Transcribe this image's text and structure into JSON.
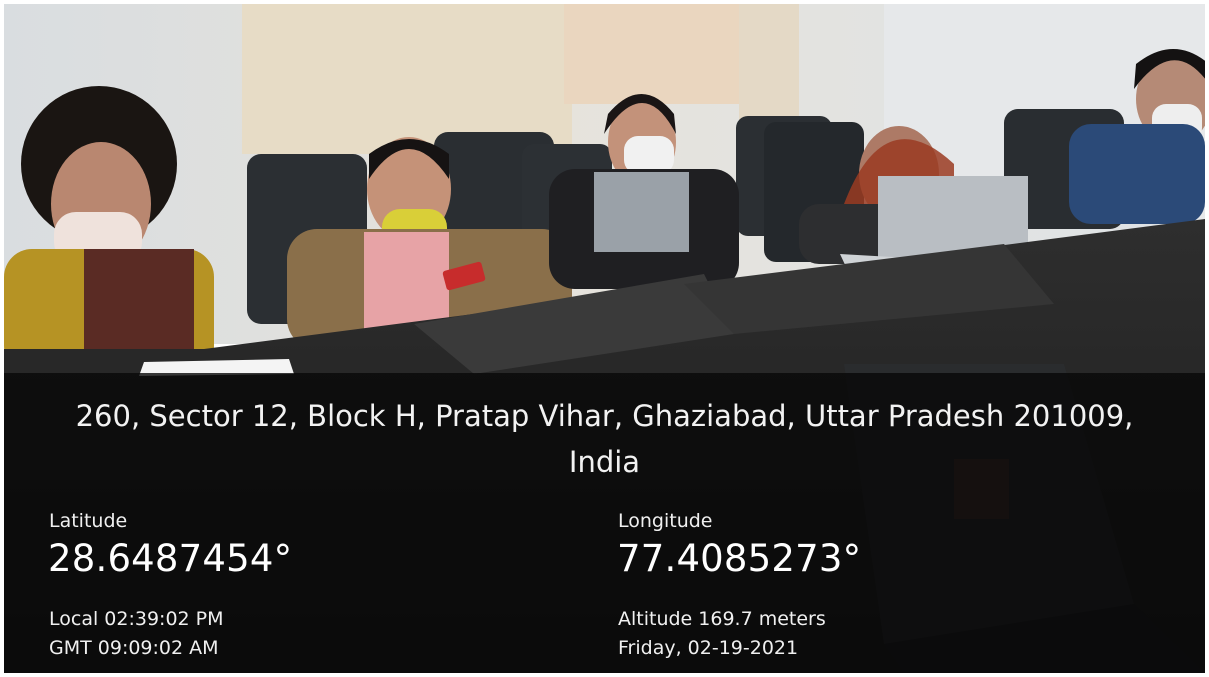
{
  "location": {
    "address_line1": "260, Sector 12, Block H, Pratap Vihar, Ghaziabad, Uttar Pradesh 201009,",
    "address_line2": "India"
  },
  "coordinates": {
    "latitude_label": "Latitude",
    "latitude_value": "28.6487454°",
    "longitude_label": "Longitude",
    "longitude_value": "77.4085273°"
  },
  "time": {
    "local": "Local 02:39:02 PM",
    "gmt": "GMT 09:09:02 AM"
  },
  "meta": {
    "altitude": "Altitude 169.7 meters",
    "date": "Friday, 02-19-2021"
  }
}
